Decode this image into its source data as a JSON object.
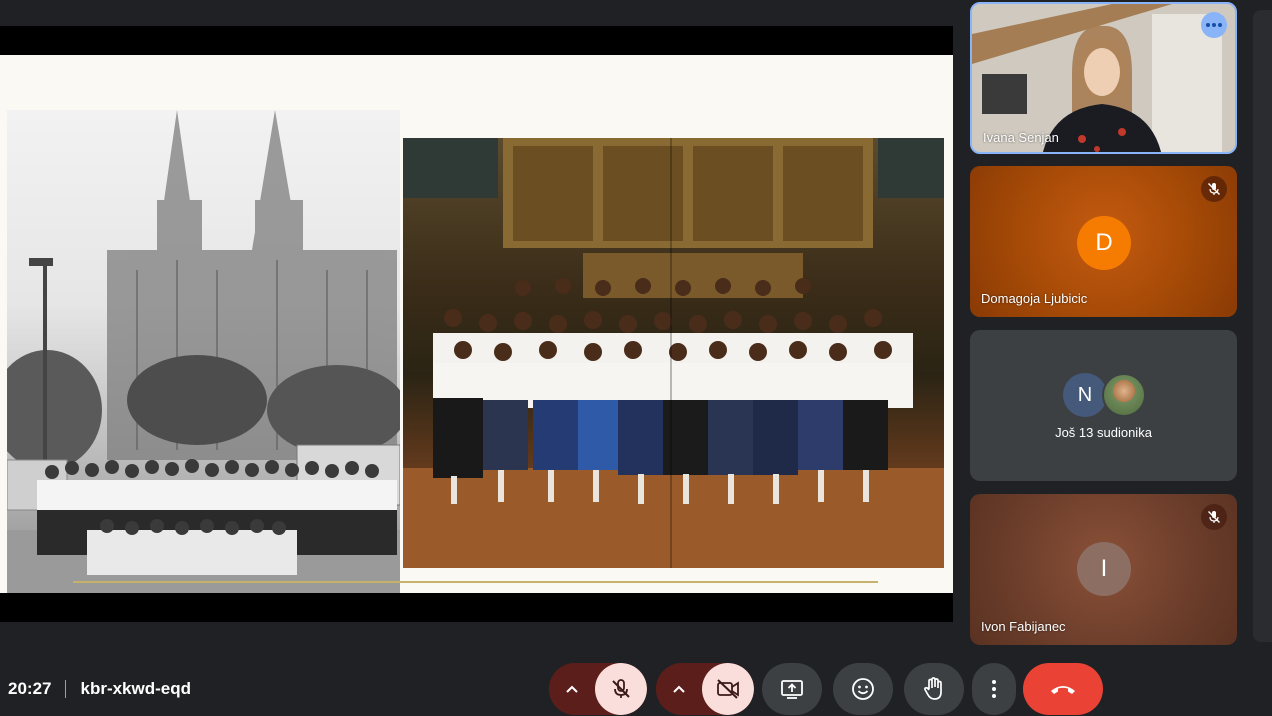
{
  "meeting": {
    "time": "20:27",
    "code": "kbr-xkwd-eqd"
  },
  "participants": [
    {
      "name": "Ivana Senjan",
      "type": "video"
    },
    {
      "name": "Domagoja Ljubicic",
      "initial": "D",
      "avatar_color": "#f57c00",
      "tile_color": "#a54a07",
      "muted": true
    },
    {
      "label": "Još 13 sudionika",
      "initials": [
        "N"
      ],
      "avatar_color": "#455a7a",
      "tile_color": "#3c4043"
    },
    {
      "name": "Ivon Fabijanec",
      "initial": "I",
      "avatar_color": "#8d6e63",
      "tile_color": "#6b3d2a",
      "muted": true
    }
  ],
  "icons": {
    "more": "three-dots-icon",
    "mic": "mic-off-icon",
    "camera": "camera-off-icon",
    "present": "present-screen-icon",
    "reactions": "emoji-icon",
    "raise_hand": "raise-hand-icon",
    "options": "more-options-icon",
    "end_call": "end-call-icon",
    "arrow": "chevron-up-icon"
  },
  "colors": {
    "accent_blue": "#8ab4f8",
    "end_call": "#ea4335",
    "muted_control_bg": "#f9dedc"
  }
}
